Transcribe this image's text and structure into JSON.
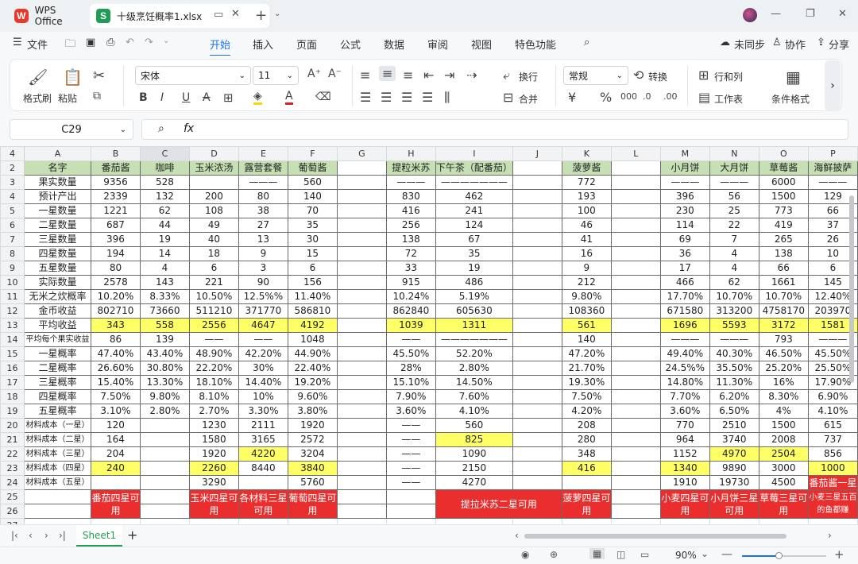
{
  "app": {
    "name": "WPS Office",
    "file_tab": "十级烹饪概率1.xlsx"
  },
  "menu": [
    "文件",
    "开始",
    "插入",
    "页面",
    "公式",
    "数据",
    "审阅",
    "视图",
    "特色功能"
  ],
  "topright": {
    "unsync": "未同步",
    "collab": "协作",
    "share": "分享"
  },
  "ribbon": {
    "format_painter": "格式刷",
    "paste": "粘贴",
    "font_name": "宋体",
    "font_size": "11",
    "wrap": "换行",
    "merge": "合并",
    "number_format": "常规",
    "convert": "转换",
    "rows_cols": "行和列",
    "worksheet": "工作表",
    "cond_format": "条件格式"
  },
  "formula": {
    "name_box": "C29",
    "fx": "fx"
  },
  "columns": [
    "A",
    "B",
    "C",
    "D",
    "E",
    "F",
    "G",
    "H",
    "I",
    "J",
    "K",
    "L",
    "M",
    "N",
    "O",
    "P"
  ],
  "rows": [
    [
      "名字",
      "番茄酱",
      "咖啡",
      "玉米浓汤",
      "露营套餐",
      "葡萄酱",
      "",
      "提粒米苏",
      "下午茶（配番茄）",
      "",
      "菠萝酱",
      "",
      "小月饼",
      "大月饼",
      "草莓酱",
      "海鲜披萨"
    ],
    [
      "果实数量",
      "9356",
      "528",
      "",
      "———",
      "560",
      "",
      "———",
      "———————",
      "",
      "772",
      "",
      "———",
      "———",
      "6000",
      "———"
    ],
    [
      "预计产出",
      "2339",
      "132",
      "200",
      "80",
      "140",
      "",
      "830",
      "462",
      "",
      "193",
      "",
      "396",
      "56",
      "1500",
      "129"
    ],
    [
      "一星数量",
      "1221",
      "62",
      "108",
      "38",
      "70",
      "",
      "416",
      "241",
      "",
      "100",
      "",
      "230",
      "25",
      "773",
      "66"
    ],
    [
      "二星数量",
      "687",
      "44",
      "49",
      "27",
      "35",
      "",
      "256",
      "124",
      "",
      "46",
      "",
      "114",
      "22",
      "419",
      "37"
    ],
    [
      "三星数量",
      "396",
      "19",
      "40",
      "13",
      "30",
      "",
      "138",
      "67",
      "",
      "41",
      "",
      "69",
      "7",
      "265",
      "26"
    ],
    [
      "四星数量",
      "194",
      "14",
      "18",
      "9",
      "15",
      "",
      "72",
      "35",
      "",
      "16",
      "",
      "36",
      "4",
      "138",
      "10"
    ],
    [
      "五星数量",
      "80",
      "4",
      "6",
      "3",
      "6",
      "",
      "33",
      "19",
      "",
      "9",
      "",
      "17",
      "4",
      "66",
      "6"
    ],
    [
      "实际数量",
      "2578",
      "143",
      "221",
      "90",
      "156",
      "",
      "915",
      "486",
      "",
      "212",
      "",
      "466",
      "62",
      "1661",
      "145"
    ],
    [
      "无米之炊概率",
      "10.20%",
      "8.33%",
      "10.50%",
      "12.5%%",
      "11.40%",
      "",
      "10.24%",
      "5.19%",
      "",
      "9.80%",
      "",
      "17.70%",
      "10.70%",
      "10.70%",
      "12.40%"
    ],
    [
      "金币收益",
      "802710",
      "73660",
      "511210",
      "371770",
      "586810",
      "",
      "862840",
      "605630",
      "",
      "108360",
      "",
      "671580",
      "313200",
      "4758170",
      "203970"
    ],
    [
      "平均收益",
      "343",
      "558",
      "2556",
      "4647",
      "4192",
      "",
      "1039",
      "1311",
      "",
      "561",
      "",
      "1696",
      "5593",
      "3172",
      "1581"
    ],
    [
      "平均每个果实收益",
      "86",
      "139",
      "——",
      "——",
      "1048",
      "",
      "——",
      "———————",
      "",
      "140",
      "",
      "———",
      "———",
      "793",
      "———"
    ],
    [
      "一星概率",
      "47.40%",
      "43.40%",
      "48.90%",
      "42.20%",
      "44.90%",
      "",
      "45.50%",
      "52.20%",
      "",
      "47.20%",
      "",
      "49.40%",
      "40.30%",
      "46.50%",
      "45.50%"
    ],
    [
      "二星概率",
      "26.60%",
      "30.80%",
      "22.20%",
      "30%",
      "22.40%",
      "",
      "28%",
      "2.80%",
      "",
      "21.70%",
      "",
      "24.5%%",
      "35.50%",
      "25.20%",
      "25.50%"
    ],
    [
      "三星概率",
      "15.40%",
      "13.30%",
      "18.10%",
      "14.40%",
      "19.20%",
      "",
      "15.10%",
      "14.50%",
      "",
      "19.30%",
      "",
      "14.80%",
      "11.30%",
      "16%",
      "17.90%"
    ],
    [
      "四星概率",
      "7.50%",
      "9.80%",
      "8.10%",
      "10%",
      "9.60%",
      "",
      "7.90%",
      "7.60%",
      "",
      "7.50%",
      "",
      "7.70%",
      "6.20%",
      "8.30%",
      "6.90%"
    ],
    [
      "五星概率",
      "3.10%",
      "2.80%",
      "2.70%",
      "3.30%",
      "3.80%",
      "",
      "3.60%",
      "4.10%",
      "",
      "4.20%",
      "",
      "3.60%",
      "6.50%",
      "4%",
      "4.10%"
    ],
    [
      "材料成本（一星）",
      "120",
      "",
      "1230",
      "2111",
      "1920",
      "",
      "——",
      "560",
      "",
      "208",
      "",
      "770",
      "2510",
      "1500",
      "615"
    ],
    [
      "材料成本（二星）",
      "164",
      "",
      "1580",
      "3165",
      "2572",
      "",
      "——",
      "825",
      "",
      "280",
      "",
      "964",
      "3740",
      "2008",
      "737"
    ],
    [
      "材料成本（三星）",
      "204",
      "",
      "1920",
      "4220",
      "3204",
      "",
      "——",
      "1090",
      "",
      "348",
      "",
      "1152",
      "4970",
      "2504",
      "856"
    ],
    [
      "材料成本（四星）",
      "240",
      "",
      "2260",
      "8440",
      "3840",
      "",
      "——",
      "2150",
      "",
      "416",
      "",
      "1340",
      "9890",
      "3000",
      "1000"
    ],
    [
      "材料成本（五星）",
      "",
      "",
      "3290",
      "",
      "5760",
      "",
      "——",
      "4270",
      "",
      "",
      "",
      "1910",
      "19730",
      "4500",
      "番茄酱一星"
    ]
  ],
  "notes": {
    "B": "番茄四星可用",
    "D": "玉米四星可用",
    "E": "各材料三星可用",
    "F": "葡萄四星可用",
    "I": "提拉米苏二星可用",
    "K": "菠萝四星可用",
    "M": "小麦四星可用",
    "N": "小月饼三星可用",
    "O": "草莓三星可用",
    "P": "小麦三星五百的鱼都赚"
  },
  "status": {
    "sheet": "Sheet1",
    "zoom": "90%"
  }
}
